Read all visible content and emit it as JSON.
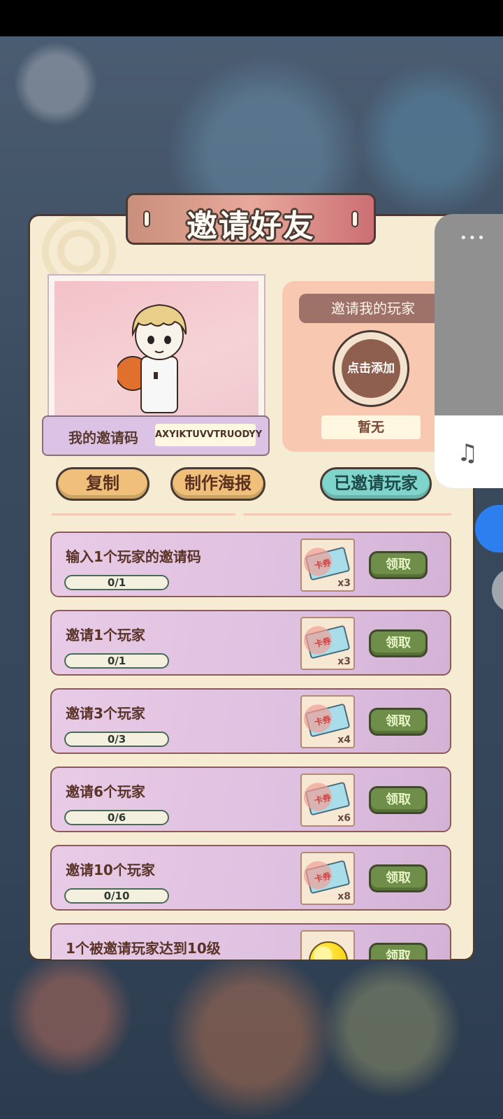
{
  "title": "邀请好友",
  "invite_code": {
    "label": "我的邀请码",
    "value": "AXYIKTUVVTRUODYY"
  },
  "inviter": {
    "header": "邀请我的玩家",
    "add_label": "点击添加",
    "status": "暂无"
  },
  "buttons": {
    "copy": "复制",
    "poster": "制作海报",
    "invited": "已邀请玩家"
  },
  "tasks": [
    {
      "title": "输入1个玩家的邀请码",
      "progress": "0/1",
      "reward_icon": "ticket-icon",
      "reward_label": "卡券",
      "reward_qty": "x3",
      "claim": "领取"
    },
    {
      "title": "邀请1个玩家",
      "progress": "0/1",
      "reward_icon": "ticket-icon",
      "reward_label": "卡券",
      "reward_qty": "x3",
      "claim": "领取"
    },
    {
      "title": "邀请3个玩家",
      "progress": "0/3",
      "reward_icon": "ticket-icon",
      "reward_label": "卡券",
      "reward_qty": "x4",
      "claim": "领取"
    },
    {
      "title": "邀请6个玩家",
      "progress": "0/6",
      "reward_icon": "ticket-icon",
      "reward_label": "卡券",
      "reward_qty": "x6",
      "claim": "领取"
    },
    {
      "title": "邀请10个玩家",
      "progress": "0/10",
      "reward_icon": "ticket-icon",
      "reward_label": "卡券",
      "reward_qty": "x8",
      "claim": "领取"
    },
    {
      "title": "1个被邀请玩家达到10级",
      "progress": "",
      "reward_icon": "coin-icon",
      "reward_label": "",
      "reward_qty": "",
      "claim": "领取"
    }
  ],
  "overlay": {
    "dots": "•••",
    "music_icon": "music-note-icon"
  },
  "colors": {
    "panel_bg": "#f6ecd3",
    "claim_green": "#6f8e4a",
    "invited_teal": "#7fd4cb",
    "button_orange": "#f0c07a"
  }
}
